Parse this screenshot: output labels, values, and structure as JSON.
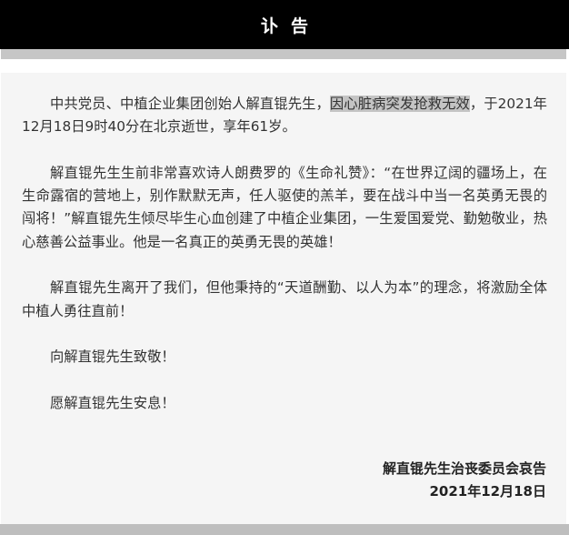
{
  "header": {
    "title": "讣告"
  },
  "body": {
    "p1_before": "中共党员、中植企业集团创始人解直锟先生，",
    "p1_highlight": "因心脏病突发抢救无效",
    "p1_after": "，于2021年12月18日9时40分在北京逝世，享年61岁。",
    "p2": "解直锟先生生前非常喜欢诗人朗费罗的《生命礼赞》：“在世界辽阔的疆场上，在生命露宿的营地上，别作默默无声，任人驱使的羔羊，要在战斗中当一名英勇无畏的闯将！”解直锟先生倾尽毕生心血创建了中植企业集团，一生爱国爱党、勤勉敬业，热心慈善公益事业。他是一名真正的英勇无畏的英雄！",
    "p3": "解直锟先生离开了我们，但他秉持的“天道酬勤、以人为本”的理念，将激励全体中植人勇往直前！",
    "p4": "向解直锟先生致敬！",
    "p5": "愿解直锟先生安息！"
  },
  "signature": {
    "org": "解直锟先生治丧委员会哀告",
    "date": "2021年12月18日"
  }
}
